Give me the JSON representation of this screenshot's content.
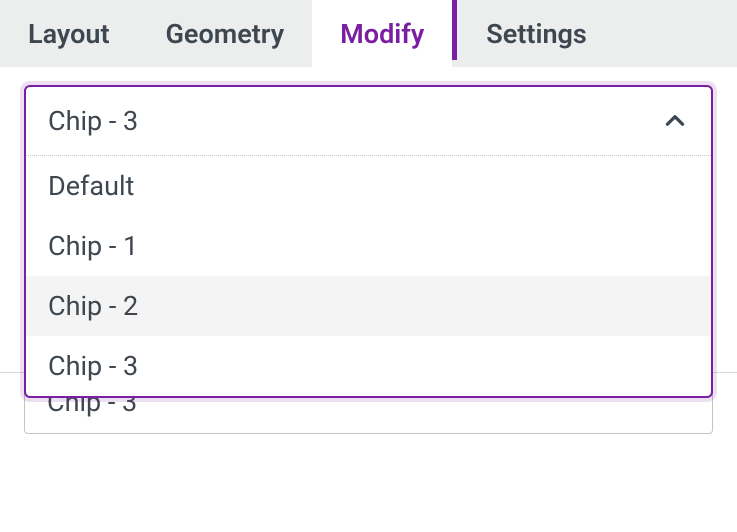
{
  "tabs": [
    {
      "label": "Layout",
      "active": false
    },
    {
      "label": "Geometry",
      "active": false
    },
    {
      "label": "Modify",
      "active": true
    },
    {
      "label": "Settings",
      "active": false
    }
  ],
  "selector": {
    "selected": "Chip - 3",
    "options": [
      {
        "label": "Default",
        "highlight": false
      },
      {
        "label": "Chip - 1",
        "highlight": false
      },
      {
        "label": "Chip - 2",
        "highlight": true
      },
      {
        "label": "Chip - 3",
        "highlight": false
      }
    ]
  },
  "back_selector": {
    "value": "Chip - 3"
  },
  "colors": {
    "accent": "#7b1fa2",
    "text": "#3e474f"
  }
}
